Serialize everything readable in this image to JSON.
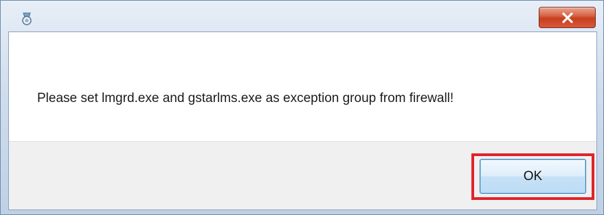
{
  "window": {
    "icon": "app-icon",
    "close_symbol": "close-x-icon"
  },
  "dialog": {
    "message": "Please set lmgrd.exe and gstarlms.exe as exception group from firewall!",
    "ok_label": "OK"
  },
  "colors": {
    "highlight": "#e0232c",
    "close_button": "#c7401f",
    "ok_button": "#c6e1f7"
  }
}
